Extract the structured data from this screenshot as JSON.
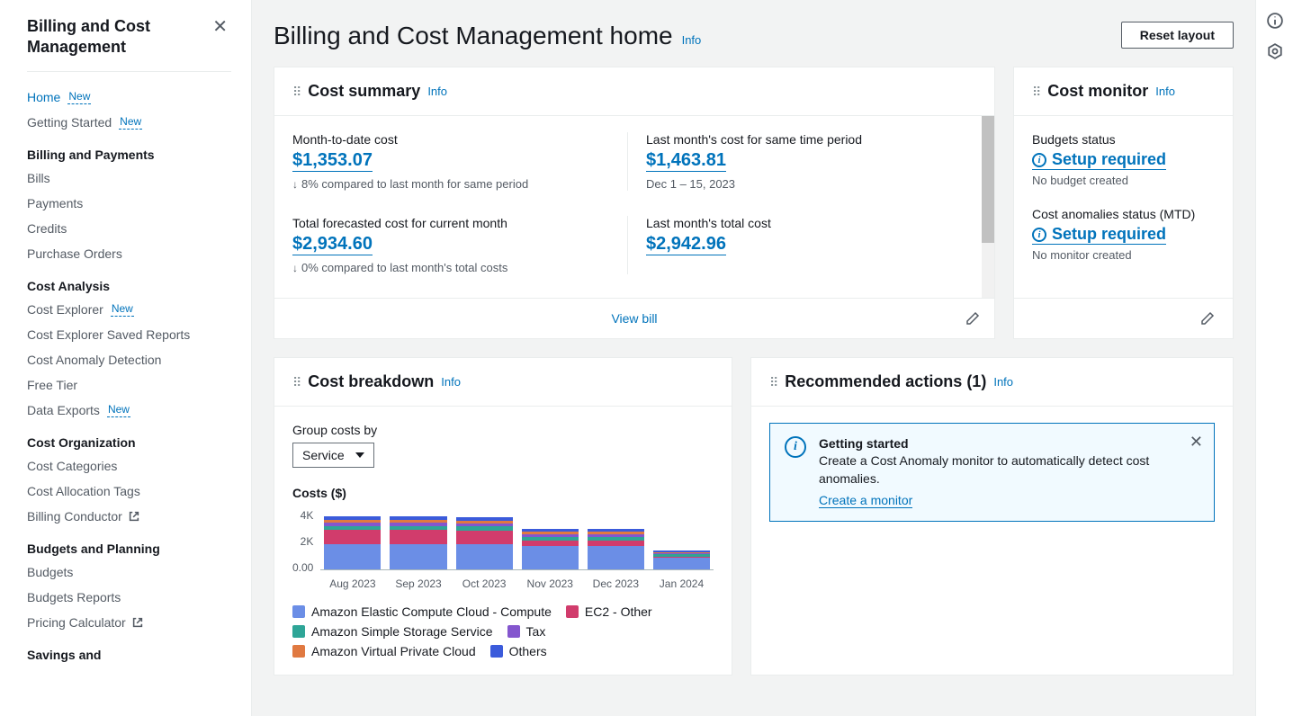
{
  "sidebar": {
    "title": "Billing and Cost Management",
    "groups": [
      {
        "items": [
          {
            "label": "Home",
            "new": true,
            "active": true
          },
          {
            "label": "Getting Started",
            "new": true
          }
        ]
      },
      {
        "heading": "Billing and Payments",
        "items": [
          {
            "label": "Bills"
          },
          {
            "label": "Payments"
          },
          {
            "label": "Credits"
          },
          {
            "label": "Purchase Orders"
          }
        ]
      },
      {
        "heading": "Cost Analysis",
        "items": [
          {
            "label": "Cost Explorer",
            "new": true
          },
          {
            "label": "Cost Explorer Saved Reports"
          },
          {
            "label": "Cost Anomaly Detection"
          },
          {
            "label": "Free Tier"
          },
          {
            "label": "Data Exports",
            "new": true
          }
        ]
      },
      {
        "heading": "Cost Organization",
        "items": [
          {
            "label": "Cost Categories"
          },
          {
            "label": "Cost Allocation Tags"
          },
          {
            "label": "Billing Conductor",
            "ext": true
          }
        ]
      },
      {
        "heading": "Budgets and Planning",
        "items": [
          {
            "label": "Budgets"
          },
          {
            "label": "Budgets Reports"
          },
          {
            "label": "Pricing Calculator",
            "ext": true
          }
        ]
      },
      {
        "heading": "Savings and",
        "items": []
      }
    ]
  },
  "page": {
    "title": "Billing and Cost Management home",
    "info": "Info",
    "reset": "Reset layout"
  },
  "cost_summary": {
    "title": "Cost summary",
    "info": "Info",
    "view_bill": "View bill",
    "metrics": [
      {
        "label": "Month-to-date cost",
        "value": "$1,353.07",
        "sub": "8% compared to last month for same period",
        "arrow": true
      },
      {
        "label": "Last month's cost for same time period",
        "value": "$1,463.81",
        "sub": "Dec 1 – 15, 2023"
      },
      {
        "label": "Total forecasted cost for current month",
        "value": "$2,934.60",
        "sub": "0% compared to last month's total costs",
        "arrow": true
      },
      {
        "label": "Last month's total cost",
        "value": "$2,942.96"
      }
    ]
  },
  "cost_monitor": {
    "title": "Cost monitor",
    "info": "Info",
    "blocks": [
      {
        "label": "Budgets status",
        "link": "Setup required",
        "sub": "No budget created"
      },
      {
        "label": "Cost anomalies status (MTD)",
        "link": "Setup required",
        "sub": "No monitor created"
      }
    ]
  },
  "cost_breakdown": {
    "title": "Cost breakdown",
    "info": "Info",
    "group_label": "Group costs by",
    "group_value": "Service",
    "y_title": "Costs ($)",
    "legend": [
      {
        "name": "Amazon Elastic Compute Cloud - Compute",
        "color": "#6b8ee6"
      },
      {
        "name": "EC2 - Other",
        "color": "#d13c6c"
      },
      {
        "name": "Amazon Simple Storage Service",
        "color": "#2ea597"
      },
      {
        "name": "Tax",
        "color": "#8456ce"
      },
      {
        "name": "Amazon Virtual Private Cloud",
        "color": "#e07941"
      },
      {
        "name": "Others",
        "color": "#3b5bdb"
      }
    ]
  },
  "recommended": {
    "title": "Recommended actions (1)",
    "info": "Info",
    "alert": {
      "title": "Getting started",
      "text": "Create a Cost Anomaly monitor to automatically detect cost anomalies.",
      "link": "Create a monitor"
    }
  },
  "chart_data": {
    "type": "bar",
    "stacked": true,
    "title": "Costs ($)",
    "xlabel": "",
    "ylabel": "Costs ($)",
    "ylim": [
      0,
      4000
    ],
    "yticks": [
      0,
      2000,
      4000
    ],
    "ytick_labels": [
      "0.00",
      "2K",
      "4K"
    ],
    "categories": [
      "Aug 2023",
      "Sep 2023",
      "Oct 2023",
      "Nov 2023",
      "Dec 2023",
      "Jan 2024"
    ],
    "series": [
      {
        "name": "Amazon Elastic Compute Cloud - Compute",
        "color": "#6b8ee6",
        "values": [
          1600,
          1600,
          1600,
          1500,
          1500,
          800
        ]
      },
      {
        "name": "EC2 - Other",
        "color": "#d13c6c",
        "values": [
          900,
          900,
          850,
          350,
          350,
          50
        ]
      },
      {
        "name": "Amazon Simple Storage Service",
        "color": "#2ea597",
        "values": [
          250,
          250,
          250,
          220,
          220,
          150
        ]
      },
      {
        "name": "Tax",
        "color": "#8456ce",
        "values": [
          200,
          200,
          200,
          150,
          150,
          50
        ]
      },
      {
        "name": "Amazon Virtual Private Cloud",
        "color": "#e07941",
        "values": [
          150,
          150,
          150,
          150,
          150,
          50
        ]
      },
      {
        "name": "Others",
        "color": "#3b5bdb",
        "values": [
          250,
          250,
          250,
          200,
          200,
          100
        ]
      }
    ]
  }
}
